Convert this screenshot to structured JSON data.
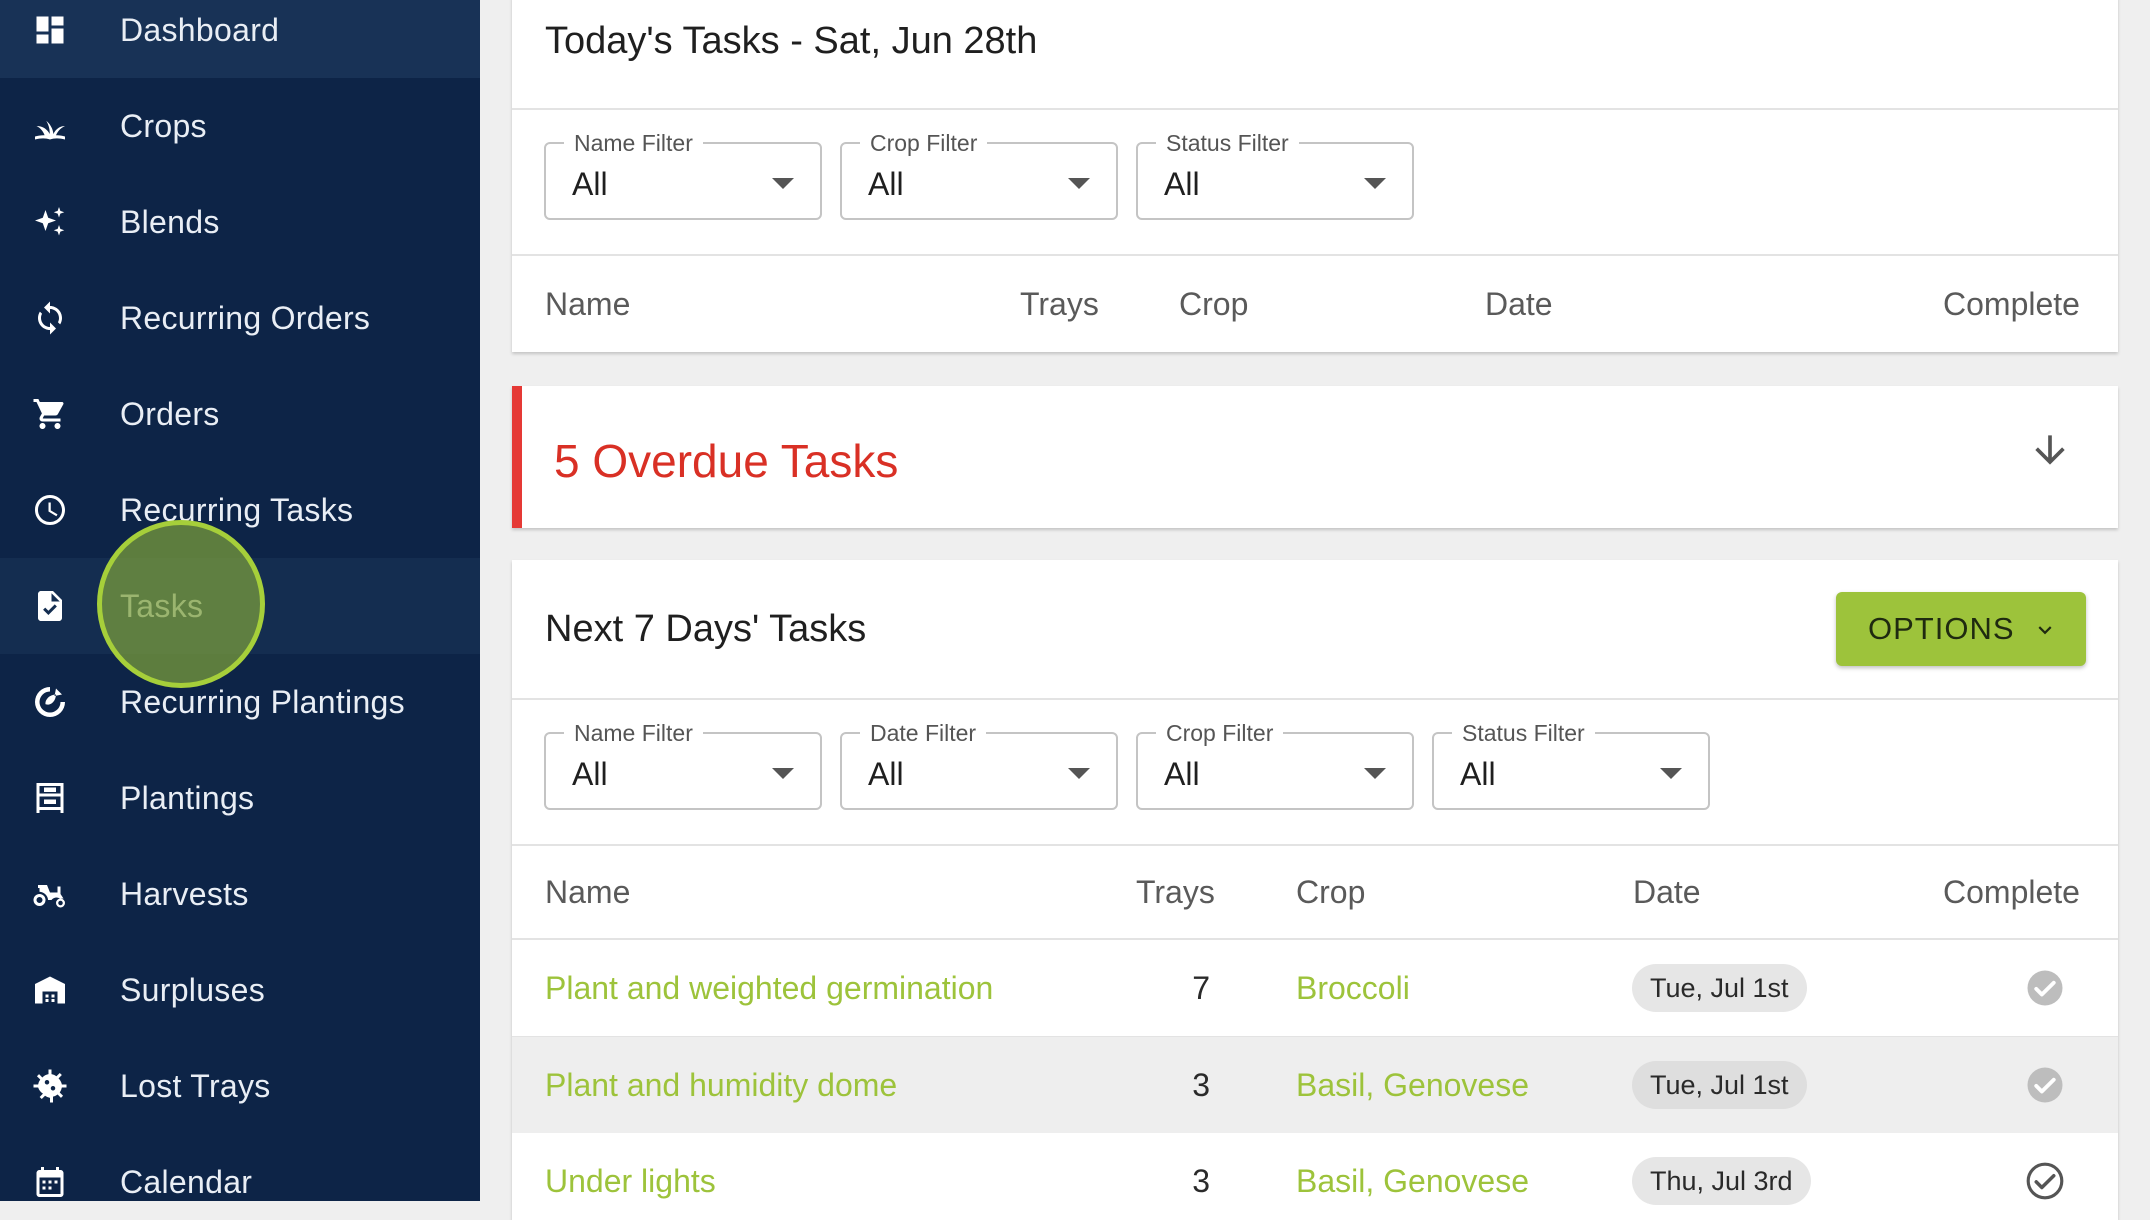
{
  "sidebar": {
    "items": [
      {
        "label": "Dashboard",
        "icon": "dashboard-icon"
      },
      {
        "label": "Crops",
        "icon": "sprout-icon"
      },
      {
        "label": "Blends",
        "icon": "sparkle-icon"
      },
      {
        "label": "Recurring Orders",
        "icon": "sync-icon"
      },
      {
        "label": "Orders",
        "icon": "cart-icon"
      },
      {
        "label": "Recurring Tasks",
        "icon": "clock-icon"
      },
      {
        "label": "Tasks",
        "icon": "task-file-icon"
      },
      {
        "label": "Recurring Plantings",
        "icon": "seed-cycle-icon"
      },
      {
        "label": "Plantings",
        "icon": "plantings-icon"
      },
      {
        "label": "Harvests",
        "icon": "tractor-icon"
      },
      {
        "label": "Surpluses",
        "icon": "warehouse-icon"
      },
      {
        "label": "Lost Trays",
        "icon": "virus-icon"
      },
      {
        "label": "Calendar",
        "icon": "calendar-icon"
      }
    ]
  },
  "today": {
    "title": "Today's Tasks - Sat, Jun 28th",
    "filters": [
      {
        "label": "Name Filter",
        "value": "All"
      },
      {
        "label": "Crop Filter",
        "value": "All"
      },
      {
        "label": "Status Filter",
        "value": "All"
      }
    ],
    "headers": {
      "name": "Name",
      "trays": "Trays",
      "crop": "Crop",
      "date": "Date",
      "complete": "Complete"
    }
  },
  "overdue": {
    "title": "5 Overdue Tasks"
  },
  "next": {
    "title": "Next 7 Days' Tasks",
    "options_label": "OPTIONS",
    "filters": [
      {
        "label": "Name Filter",
        "value": "All"
      },
      {
        "label": "Date Filter",
        "value": "All"
      },
      {
        "label": "Crop Filter",
        "value": "All"
      },
      {
        "label": "Status Filter",
        "value": "All"
      }
    ],
    "headers": {
      "name": "Name",
      "trays": "Trays",
      "crop": "Crop",
      "date": "Date",
      "complete": "Complete"
    },
    "rows": [
      {
        "name": "Plant and weighted germination",
        "trays": "7",
        "crop": "Broccoli",
        "date": "Tue, Jul 1st",
        "complete": false
      },
      {
        "name": "Plant and humidity dome",
        "trays": "3",
        "crop": "Basil, Genovese",
        "date": "Tue, Jul 1st",
        "complete": false
      },
      {
        "name": "Under lights",
        "trays": "3",
        "crop": "Basil, Genovese",
        "date": "Thu, Jul 3rd",
        "complete": false
      }
    ]
  },
  "colors": {
    "sidebar_bg": "#0d2447",
    "accent": "#9dc33b",
    "overdue": "#d93025"
  }
}
